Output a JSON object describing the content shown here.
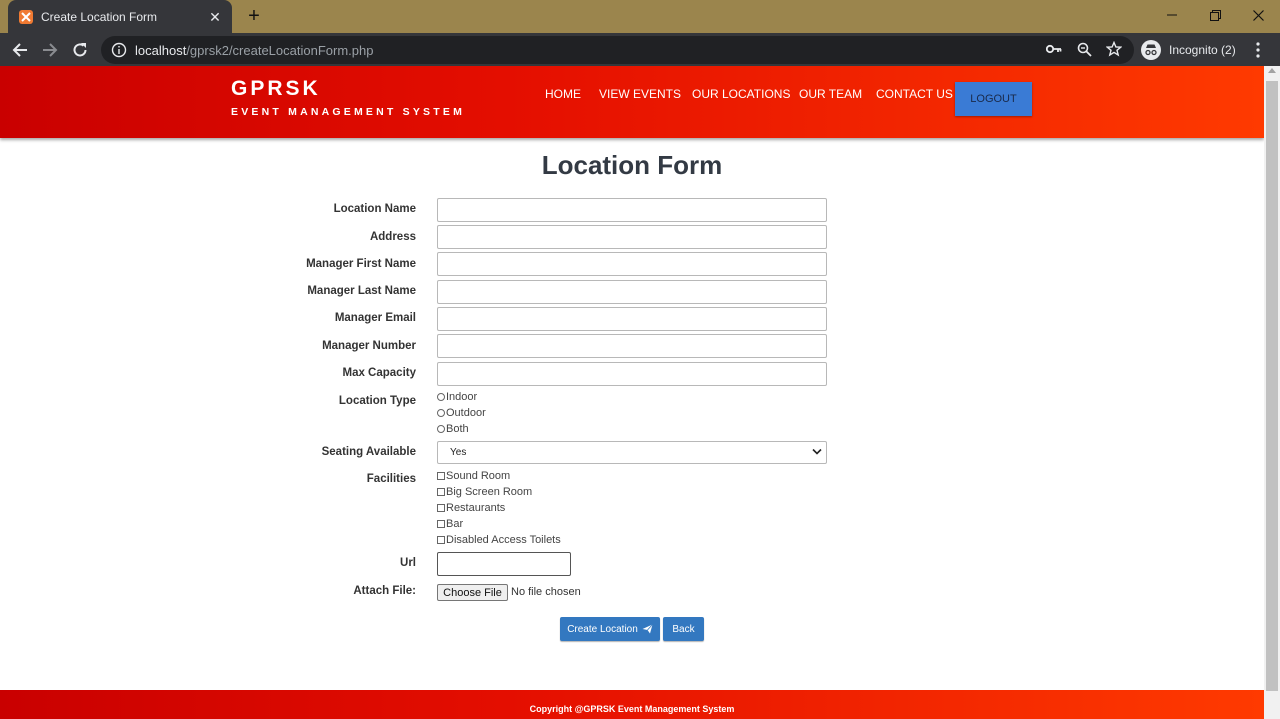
{
  "browser": {
    "tab_title": "Create Location Form",
    "url_host": "localhost",
    "url_path": "/gprsk2/createLocationForm.php",
    "profile_label": "Incognito (2)"
  },
  "site": {
    "brand_name": "GPRSK",
    "brand_tagline": "EVENT MANAGEMENT SYSTEM",
    "nav": {
      "home": "HOME",
      "view_events": "VIEW EVENTS",
      "our_locations": "OUR LOCATIONS",
      "our_team": "OUR TEAM",
      "contact_us": "CONTACT US",
      "logout": "LOGOUT"
    },
    "accent_colors": {
      "header_red": "#e40e00",
      "button_blue": "#3378c0"
    }
  },
  "form": {
    "title": "Location Form",
    "labels": {
      "location_name": "Location Name",
      "address": "Address",
      "manager_first_name": "Manager First Name",
      "manager_last_name": "Manager Last Name",
      "manager_email": "Manager Email",
      "manager_number": "Manager Number",
      "max_capacity": "Max Capacity",
      "location_type": "Location Type",
      "seating_available": "Seating Available",
      "facilities": "Facilities",
      "url": "Url",
      "attach_file": "Attach File:"
    },
    "location_types": [
      "Indoor",
      "Outdoor",
      "Both"
    ],
    "seating_value": "Yes",
    "facilities_options": [
      "Sound Room",
      "Big Screen Room",
      "Restaurants",
      "Bar",
      "Disabled Access Toilets"
    ],
    "file_button": "Choose File",
    "file_status": "No file chosen",
    "submit_label": "Create Location",
    "back_label": "Back"
  },
  "footer": {
    "copyright": "Copyright @GPRSK Event Management System"
  }
}
